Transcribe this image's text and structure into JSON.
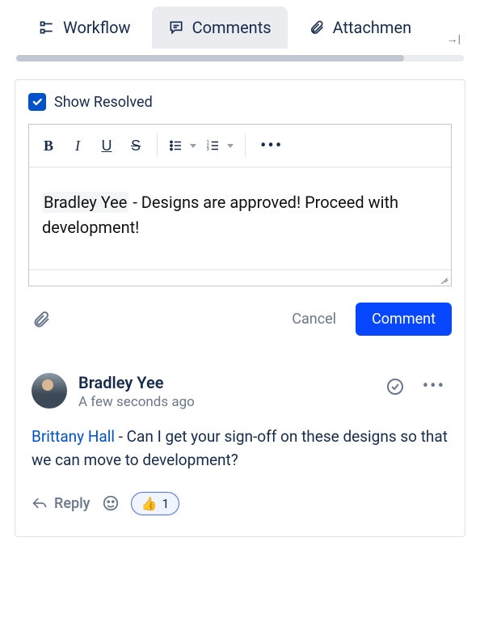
{
  "tabs": {
    "workflow": "Workflow",
    "comments": "Comments",
    "attachments": "Attachmen"
  },
  "show_resolved_label": "Show Resolved",
  "show_resolved_checked": true,
  "editor": {
    "mention": "Bradley Yee",
    "text_after": " - Designs are approved! Proceed with development!"
  },
  "actions": {
    "cancel": "Cancel",
    "submit": "Comment"
  },
  "comment": {
    "author": "Bradley Yee",
    "timestamp": "A few seconds ago",
    "mention": "Brittany Hall",
    "body_after": " - Can I get your sign-off on these designs so that we can move to development?",
    "reply_label": "Reply",
    "reaction_emoji": "👍",
    "reaction_count": "1"
  }
}
